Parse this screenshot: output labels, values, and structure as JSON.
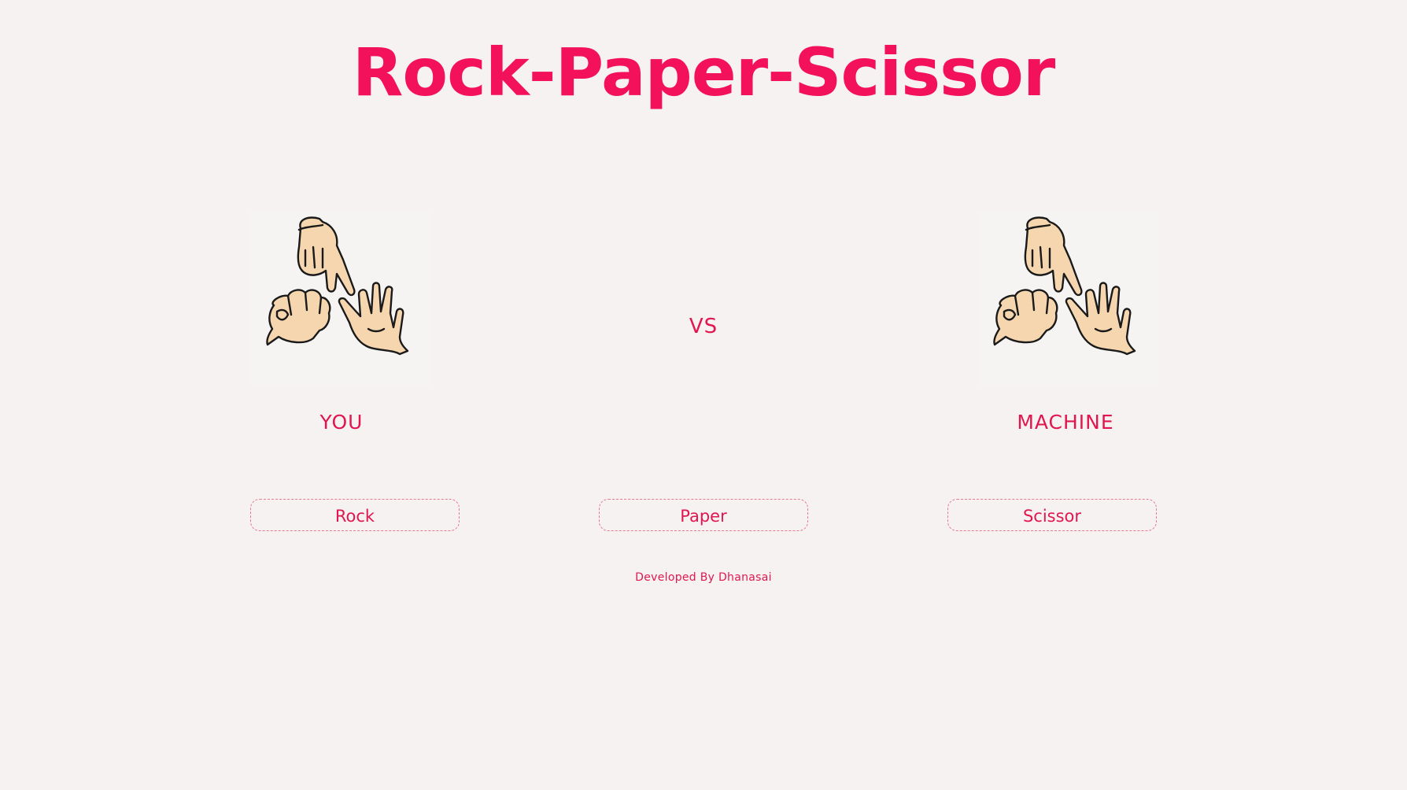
{
  "title": "Rock-Paper-Scissor",
  "vs_text": "VS",
  "players": {
    "you": "YOU",
    "machine": "MACHINE"
  },
  "choices": {
    "rock": "Rock",
    "paper": "Paper",
    "scissor": "Scissor"
  },
  "footer": "Developed By Dhanasai",
  "colors": {
    "accent": "#f2115a",
    "background": "#f7f2f2",
    "skin": "#f5d6ae",
    "outline": "#1a1a1a"
  },
  "icons": {
    "player_image": "rock-paper-scissors-hands-icon"
  }
}
